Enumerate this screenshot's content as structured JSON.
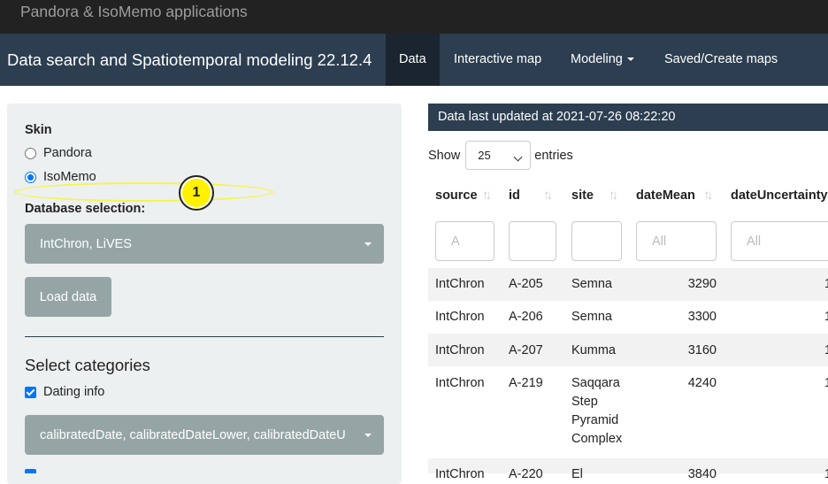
{
  "app_brand": "Pandora & IsoMemo applications",
  "navbar": {
    "title": "Data search and Spatiotemporal modeling 22.12.4",
    "tabs": [
      {
        "label": "Data",
        "active": true
      },
      {
        "label": "Interactive map",
        "active": false
      },
      {
        "label": "Modeling",
        "active": false,
        "dropdown": true
      },
      {
        "label": "Saved/Create maps",
        "active": false
      }
    ]
  },
  "sidebar": {
    "skin_label": "Skin",
    "skin_options": [
      {
        "label": "Pandora",
        "selected": false
      },
      {
        "label": "IsoMemo",
        "selected": true
      }
    ],
    "database_label": "Database selection:",
    "database_value": "IntChron, LiVES",
    "load_button": "Load data",
    "categories_heading": "Select categories",
    "dating_info_label": "Dating info",
    "dating_info_checked": true,
    "dating_fields_value": "calibratedDate, calibratedDateLower, calibratedDateU"
  },
  "annotation": {
    "number": "1",
    "color": "#fff200"
  },
  "main": {
    "updated_text": "Data last updated at 2021-07-26 08:22:20",
    "show_label": "Show",
    "entries_value": "25",
    "entries_label": "entries",
    "columns": [
      "source",
      "id",
      "site",
      "dateMean",
      "dateUncertainty"
    ],
    "filters": [
      "A",
      "",
      "",
      "All",
      "All"
    ],
    "rows": [
      {
        "source": "IntChron",
        "id": "A-205",
        "site": "Semna",
        "dateMean": "3290",
        "dateUncertainty": "1"
      },
      {
        "source": "IntChron",
        "id": "A-206",
        "site": "Semna",
        "dateMean": "3300",
        "dateUncertainty": "1"
      },
      {
        "source": "IntChron",
        "id": "A-207",
        "site": "Kumma",
        "dateMean": "3160",
        "dateUncertainty": "1"
      },
      {
        "source": "IntChron",
        "id": "A-219",
        "site": "Saqqara Step Pyramid Complex",
        "dateMean": "4240",
        "dateUncertainty": "1"
      },
      {
        "source": "IntChron",
        "id": "A-220",
        "site": "El",
        "dateMean": "3840",
        "dateUncertainty": "1"
      }
    ]
  },
  "colors": {
    "navbar": "#2c3e50",
    "topbar": "#222222",
    "sidebar": "#ecf0f1",
    "button": "#95a5a6",
    "accent": "#0075ff"
  }
}
